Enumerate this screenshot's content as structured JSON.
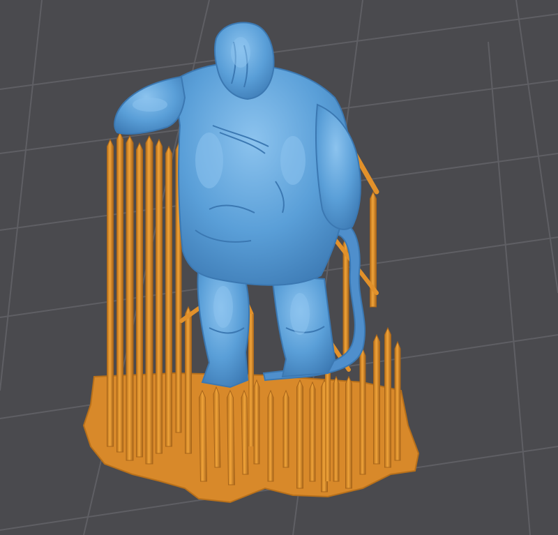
{
  "viewport": {
    "background_color": "#4a4a4e",
    "grid_line_color": "#5f5f64",
    "support_color": "#e2912a",
    "support_shadow_color": "#b8701a",
    "raft_color": "#d8892a",
    "model_color": "#5a9fd8",
    "model_shadow_color": "#3b78b2",
    "model_highlight_color": "#8cc3ee"
  }
}
